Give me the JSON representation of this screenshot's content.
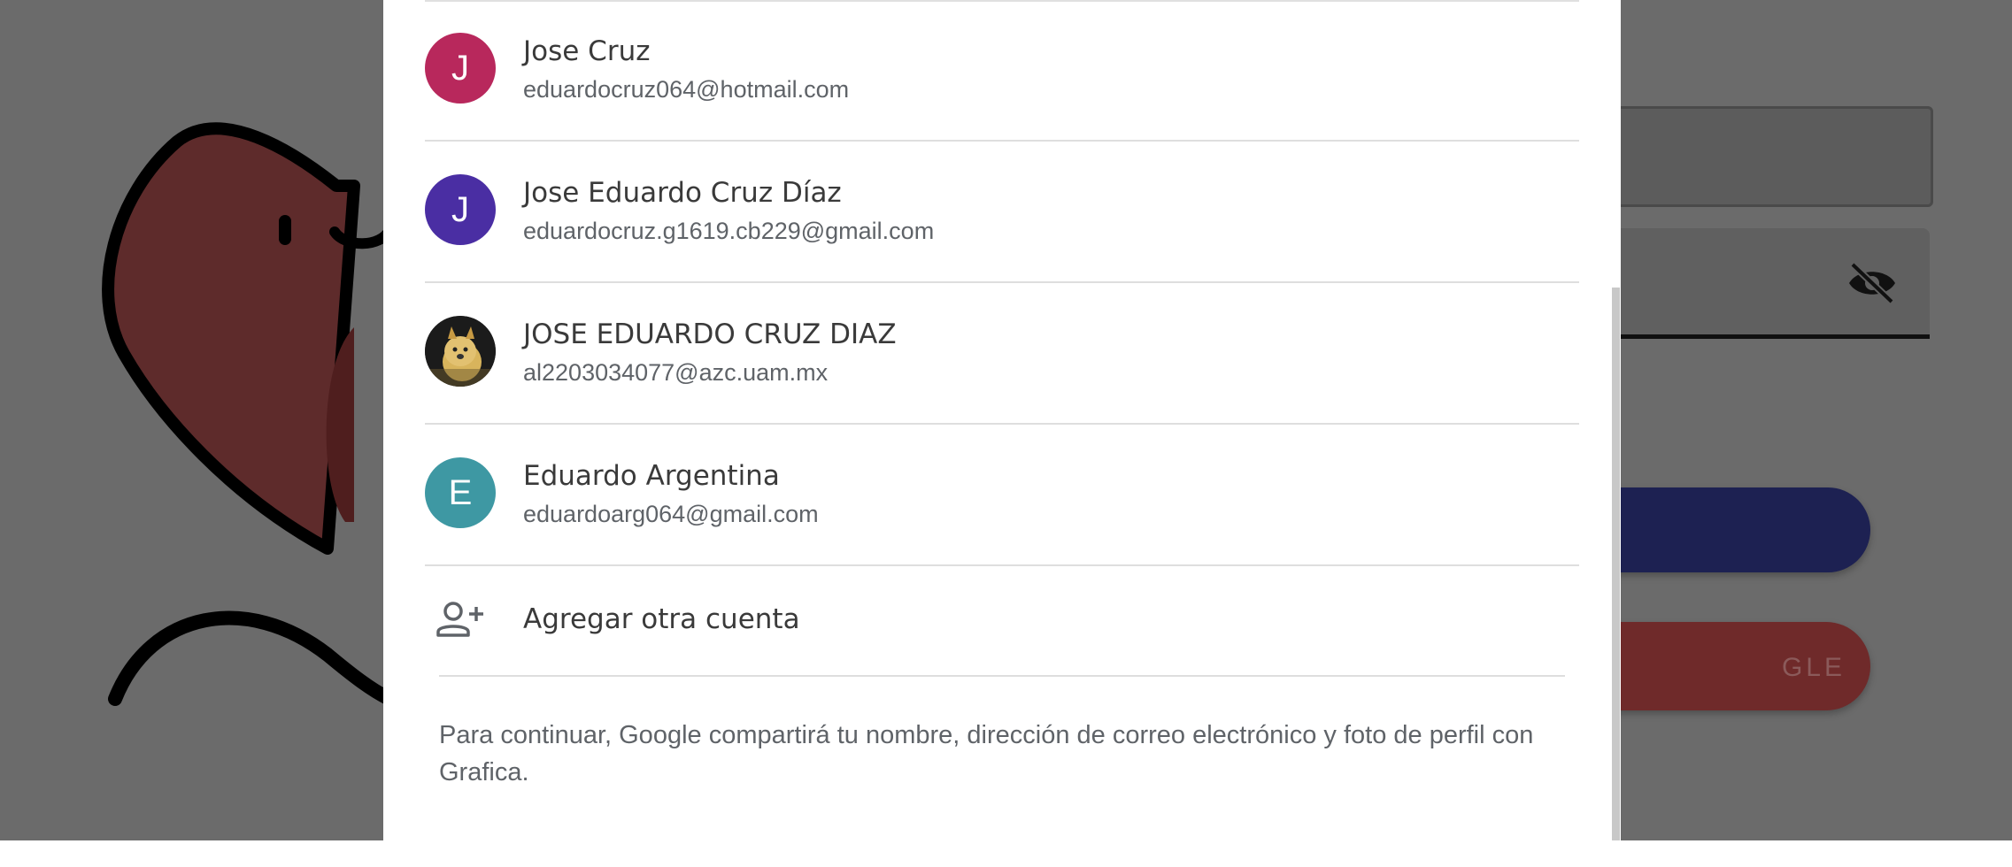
{
  "background": {
    "overlay_color": "#6b6b6b",
    "password_visibility_icon": "eye-off-icon",
    "google_button_partial_label": "GLE"
  },
  "dialog": {
    "accounts": [
      {
        "name": "Jose Cruz",
        "email": "eduardocruz064@hotmail.com",
        "avatar_letter": "J",
        "avatar_color": "#b8285c"
      },
      {
        "name": "Jose Eduardo Cruz Díaz",
        "email": "eduardocruz.g1619.cb229@gmail.com",
        "avatar_letter": "J",
        "avatar_color": "#4a2ea3"
      },
      {
        "name": "JOSE EDUARDO CRUZ DIAZ",
        "email": "al2203034077@azc.uam.mx",
        "avatar_letter": "",
        "avatar_color": "#c9a243"
      },
      {
        "name": "Eduardo Argentina",
        "email": "eduardoarg064@gmail.com",
        "avatar_letter": "E",
        "avatar_color": "#3e98a3"
      }
    ],
    "add_account": {
      "label": "Agregar otra cuenta",
      "icon": "person-add-icon"
    },
    "consent_text": "Para continuar, Google compartirá tu nombre, dirección de correo electrónico y foto de perfil con Grafica."
  }
}
